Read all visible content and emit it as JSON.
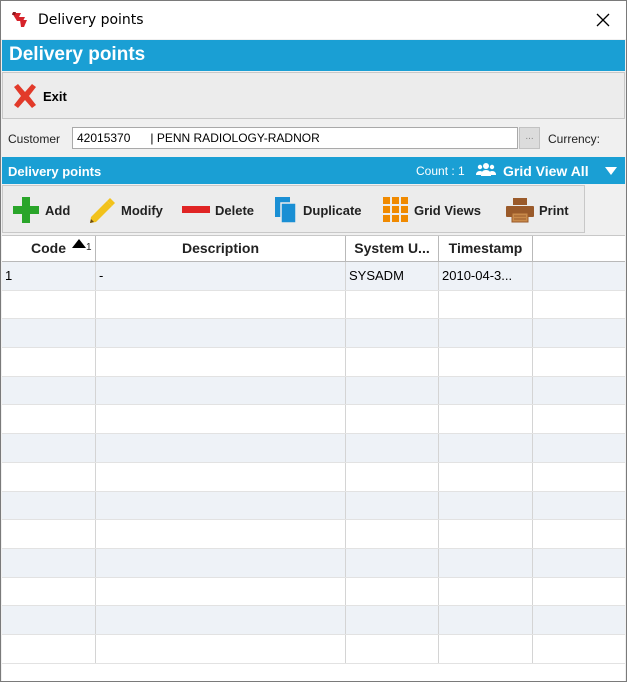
{
  "window": {
    "title": "Delivery points"
  },
  "header": {
    "title": "Delivery points"
  },
  "exit_bar": {
    "exit_label": "Exit"
  },
  "customer": {
    "label": "Customer",
    "value": "42015370      | PENN RADIOLOGY-RADNOR",
    "ellipsis": "...",
    "currency_label": "Currency:"
  },
  "section": {
    "title": "Delivery points",
    "count": "Count : 1",
    "grid_view": "Grid View All"
  },
  "toolbar": {
    "add": "Add",
    "modify": "Modify",
    "delete": "Delete",
    "duplicate": "Duplicate",
    "grid_views": "Grid Views",
    "print": "Print"
  },
  "grid": {
    "sort_index": "1",
    "columns": [
      "Code",
      "Description",
      "System U...",
      "Timestamp"
    ],
    "rows": [
      [
        "1",
        "-",
        "SYSADM",
        "2010-04-3..."
      ]
    ],
    "empty_rows": 13
  },
  "colors": {
    "accent": "#1a9fd4",
    "add_green": "#2aa52a",
    "delete_red": "#e02424",
    "modify_yellow": "#f2c21b",
    "duplicate_blue": "#1a8fd4",
    "gridviews_orange": "#f08a00",
    "print_brown": "#9a5a2a"
  }
}
